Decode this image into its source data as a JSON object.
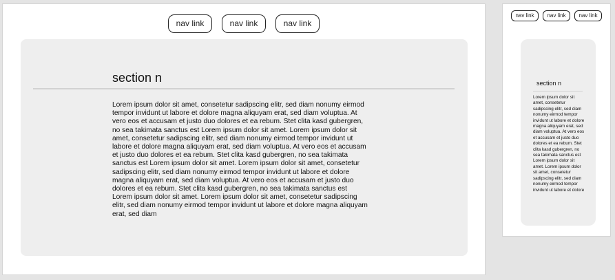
{
  "nav": {
    "links": [
      "nav link",
      "nav link",
      "nav link"
    ]
  },
  "section": {
    "title": "section n",
    "body": "Lorem ipsum dolor sit amet, consetetur sadipscing elitr, sed diam nonumy eirmod tempor invidunt ut labore et dolore magna aliquyam erat, sed diam voluptua. At vero eos et accusam et justo duo dolores et ea rebum. Stet clita kasd gubergren, no sea takimata sanctus est Lorem ipsum dolor sit amet. Lorem ipsum dolor sit amet, consetetur sadipscing elitr, sed diam nonumy eirmod tempor invidunt ut labore et dolore magna aliquyam erat, sed diam voluptua. At vero eos et accusam et justo duo dolores et ea rebum. Stet clita kasd gubergren, no sea takimata sanctus est Lorem ipsum dolor sit amet. Lorem ipsum dolor sit amet, consetetur sadipscing elitr, sed diam nonumy eirmod tempor invidunt ut labore et dolore magna aliquyam erat, sed diam voluptua. At vero eos et accusam et justo duo dolores et ea rebum. Stet clita kasd gubergren, no sea takimata sanctus est Lorem ipsum dolor sit amet. Lorem ipsum dolor sit amet, consetetur sadipscing elitr, sed diam nonumy eirmod tempor invidunt ut labore et dolore magna aliquyam erat, sed diam",
    "body_mobile": "Lorem ipsum dolor sit amet, consetetur sadipscing elitr, sed diam nonumy eirmod tempor invidunt ut labore et dolore magna aliquyam erat, sed diam voluptua. At vero eos et accusam et justo duo dolores et ea rebum. Stet clita kasd gubergren, no sea takimata sanctus est Lorem ipsum dolor sit amet. Lorem ipsum dolor sit amet, consetetur sadipscing elitr, sed diam nonumy eirmod tempor invidunt ut labore et dolore"
  },
  "colors": {
    "canvas": "#e4e4e4",
    "frame": "#ffffff",
    "card": "#eeeeee",
    "rule": "#d2d2d2",
    "border": "#222222"
  }
}
